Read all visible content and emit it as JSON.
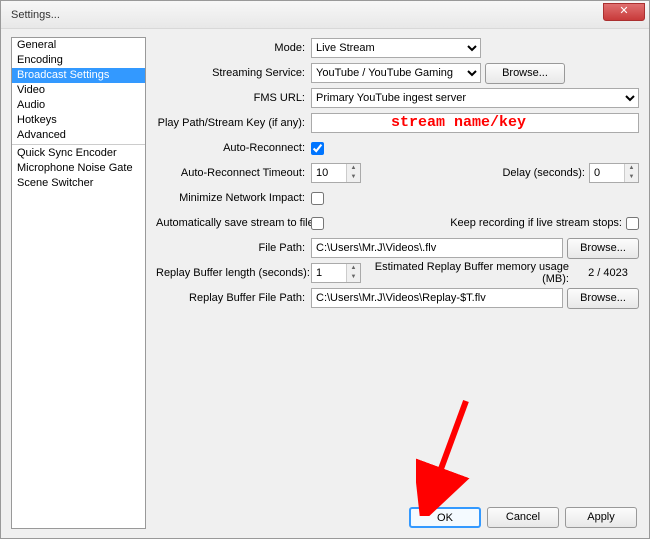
{
  "window": {
    "title": "Settings..."
  },
  "sidebar": {
    "items": [
      {
        "label": "General"
      },
      {
        "label": "Encoding"
      },
      {
        "label": "Broadcast Settings",
        "selected": true
      },
      {
        "label": "Video"
      },
      {
        "label": "Audio"
      },
      {
        "label": "Hotkeys"
      },
      {
        "label": "Advanced"
      }
    ],
    "items2": [
      {
        "label": "Quick Sync Encoder"
      },
      {
        "label": "Microphone Noise Gate"
      },
      {
        "label": "Scene Switcher"
      }
    ]
  },
  "labels": {
    "mode": "Mode:",
    "service": "Streaming Service:",
    "fms": "FMS URL:",
    "playpath": "Play Path/Stream Key (if any):",
    "autoreconnect": "Auto-Reconnect:",
    "timeout": "Auto-Reconnect Timeout:",
    "delay": "Delay (seconds):",
    "minimize": "Minimize Network Impact:",
    "autosave": "Automatically save stream to file:",
    "keeprec": "Keep recording if live stream stops:",
    "filepath": "File Path:",
    "replaylen": "Replay Buffer length (seconds):",
    "estmem": "Estimated Replay Buffer memory usage (MB):",
    "replaypath": "Replay Buffer File Path:"
  },
  "values": {
    "mode": "Live Stream",
    "service": "YouTube / YouTube Gaming",
    "fms": "Primary YouTube ingest server",
    "playpath": "",
    "autoreconnect_checked": true,
    "timeout": "10",
    "delay": "0",
    "minimize_checked": false,
    "autosave_checked": false,
    "keeprec_checked": false,
    "filepath": "C:\\Users\\Mr.J\\Videos\\.flv",
    "replaylen": "1",
    "estmem": "2 / 4023",
    "replaypath": "C:\\Users\\Mr.J\\Videos\\Replay-$T.flv"
  },
  "buttons": {
    "browse": "Browse...",
    "ok": "OK",
    "cancel": "Cancel",
    "apply": "Apply"
  },
  "annotation": "stream name/key"
}
